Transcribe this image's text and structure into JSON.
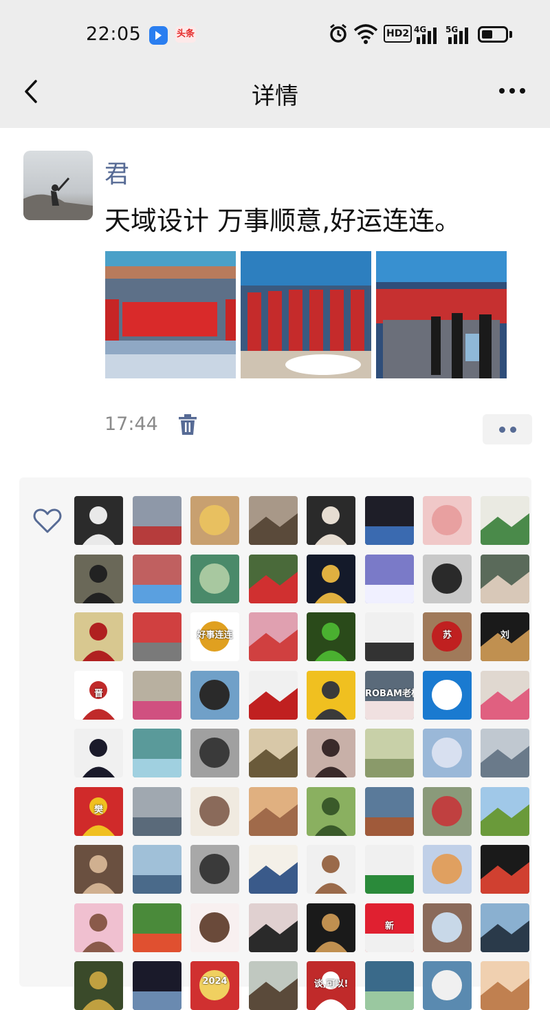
{
  "status_bar": {
    "time": "22:05",
    "notification_badges": [
      "app-blue-icon",
      "头条"
    ],
    "network_labels": [
      "4G",
      "5G"
    ],
    "hd_label": "HD2"
  },
  "nav": {
    "title": "详情",
    "back_icon": "chevron-left-icon",
    "more_icon": "ellipsis-icon"
  },
  "post": {
    "author": "君",
    "text": "天域设计 万事顺意,好运连连。",
    "image_count": 3,
    "time": "17:44",
    "delete_icon": "trash-icon"
  },
  "likes": {
    "icon": "heart-icon",
    "avatar_count": 72,
    "visible_avatar_text": {
      "avatar_1_3": "好事连连",
      "avatar_1_7": "苏",
      "avatar_1_8": "刘",
      "avatar_2_1": "晋",
      "avatar_2_6": "ROBAM老板",
      "avatar_5_2": "樊",
      "avatar_7_8": "新",
      "avatar_8_6": "谈,可以!",
      "avatar_8_3": "2024"
    }
  },
  "colors": {
    "header_bg": "#ededed",
    "author_blue": "#576b95",
    "text_dark": "#111111",
    "muted_gray": "#8a8a8a",
    "likes_panel_bg": "#f6f6f6"
  }
}
